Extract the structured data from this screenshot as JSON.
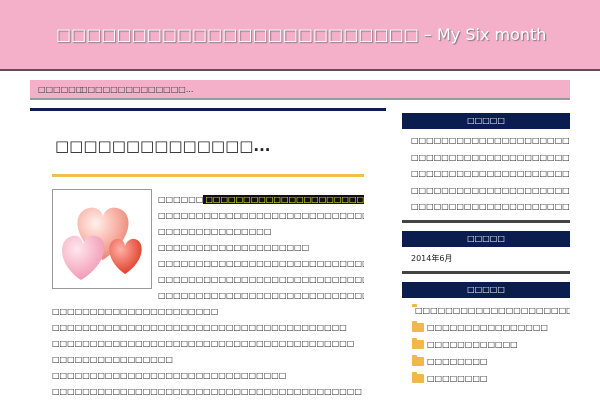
{
  "site": {
    "title": "□□□□□□□□□□□□□□□□□□□□□□□□ – My Six month"
  },
  "nav": {
    "items": [
      "□□□□□□",
      "□□□□□□□□□□□□□□..."
    ]
  },
  "post": {
    "title": "□□□□□□□□□□□□□□...",
    "highlight": "□□□□□□□□□□□□□□□□□□□□□□□□□",
    "lines": [
      "□□□□□□□□□□□□□□□□□□□□□□□□□□□□□□□□□□□□□□□□□",
      "□□□□□□□□□□□□□□□",
      "□□□□□□□□□□□□□□□□□□□□",
      "□□□□□□□□□□□□□□□□□□□□□□□□□□□□□□□□□□□□□□□",
      "□□□□□□□□□□□□□□□□□□□□□□□□□□□□",
      "□□□□□□□□□□□□□□□□□□□□□□□□□□□□□□□□□□□□□□□□□",
      "□□□□□□□□□□□□□□□□□□□□□□",
      "□□□□□□□□□□□□□□□□□□□□□□□□□□□□□□□□□□□□□□□",
      "□□□□□□□□□□□□□□□□□□□□□□□□□□□□□□□□□□□□□□□□",
      "□□□□□□□□□□□□□□□□",
      "□□□□□□□□□□□□□□□□□□□□□□□□□□□□□□□",
      "□□□□□□□□□□□□□□□□□□□□□□□□□□□□□□□□□□□□□□□□□",
      "□□□□□□□□□□□□□□□□□□□□□□□□□□□□□□□□□□□□□□□□□"
    ]
  },
  "sidebar": {
    "recent": {
      "title": "□□□□□",
      "items": [
        "□□□□□□□□□□□□□□□□□□□□□",
        "□□□□□□□□□□□□□□□□□□□□□□",
        "□□□□□□□□□□□□□□□□□□□□□□",
        "□□□□□□□□□□□□□□□□□□□□□□",
        "□□□□□□□□□□□□□□□□□□□□□"
      ]
    },
    "archive": {
      "title": "□□□□□",
      "items": [
        "2014年6月"
      ]
    },
    "categories": {
      "title": "□□□□□",
      "items": [
        "□□□□□□□□□□□□□□□□□□□□□",
        "□□□□□□□□□□□□□□□□",
        "□□□□□□□□□□□□",
        "□□□□□□□□",
        "□□□□□□□□"
      ]
    }
  },
  "colors": {
    "header": "#f4b0c9",
    "navy": "#0b1d4e",
    "accent": "#f0c14a",
    "highlight_bg": "#111111",
    "highlight_fg": "#ffff33"
  }
}
